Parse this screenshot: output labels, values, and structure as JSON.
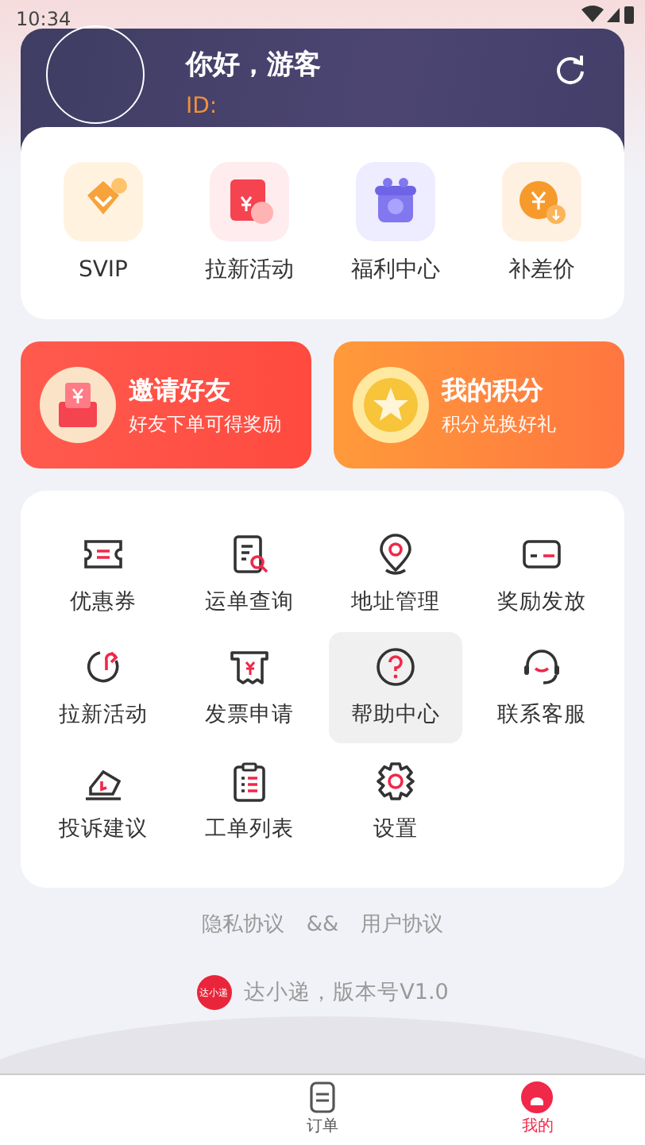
{
  "status_bar": {
    "time": "10:34"
  },
  "profile": {
    "greeting": "你好，游客",
    "id_label": "ID:"
  },
  "quick_entries": [
    {
      "label": "SVIP",
      "kind": "vip"
    },
    {
      "label": "拉新活动",
      "kind": "redpacket"
    },
    {
      "label": "福利中心",
      "kind": "gift"
    },
    {
      "label": "补差价",
      "kind": "coin"
    }
  ],
  "promos": [
    {
      "title": "邀请好友",
      "subtitle": "好友下单可得奖励",
      "kind": "invite"
    },
    {
      "title": "我的积分",
      "subtitle": "积分兑换好礼",
      "kind": "points"
    }
  ],
  "services": [
    {
      "label": "优惠券",
      "kind": "coupon",
      "highlighted": false
    },
    {
      "label": "运单查询",
      "kind": "waybill",
      "highlighted": false
    },
    {
      "label": "地址管理",
      "kind": "location",
      "highlighted": false
    },
    {
      "label": "奖励发放",
      "kind": "card",
      "highlighted": false
    },
    {
      "label": "拉新活动",
      "kind": "refresh",
      "highlighted": false
    },
    {
      "label": "发票申请",
      "kind": "invoice",
      "highlighted": false
    },
    {
      "label": "帮助中心",
      "kind": "help",
      "highlighted": true
    },
    {
      "label": "联系客服",
      "kind": "headset",
      "highlighted": false
    },
    {
      "label": "投诉建议",
      "kind": "complaint",
      "highlighted": false
    },
    {
      "label": "工单列表",
      "kind": "clipboard",
      "highlighted": false
    },
    {
      "label": "设置",
      "kind": "settings",
      "highlighted": false
    }
  ],
  "footer": {
    "privacy_link": "隐私协议",
    "separator": "&&",
    "user_link": "用户协议",
    "app_logo_text": "达小递",
    "version": "达小递，版本号V1.0"
  },
  "bottom_nav": [
    {
      "label": "订单",
      "kind": "order",
      "selected": false
    },
    {
      "label": "我的",
      "kind": "mine",
      "selected": true
    }
  ]
}
